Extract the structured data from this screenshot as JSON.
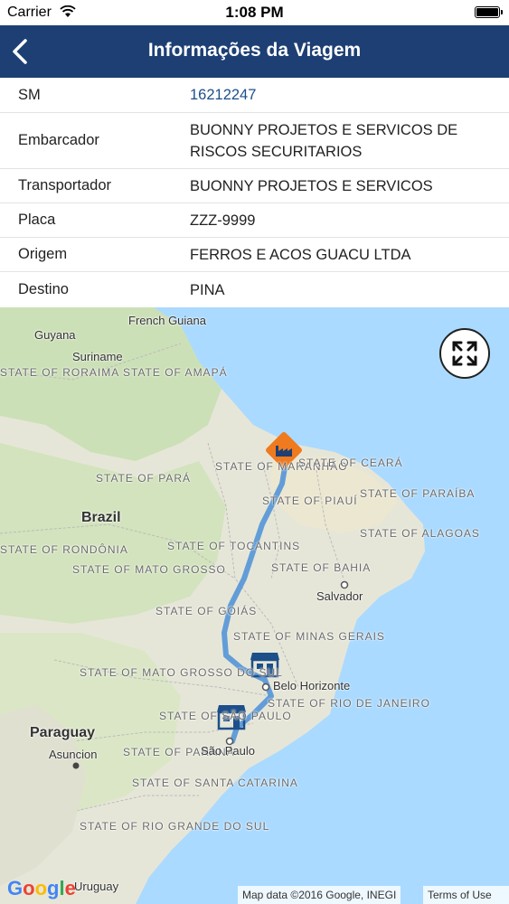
{
  "status_bar": {
    "carrier": "Carrier",
    "time": "1:08 PM"
  },
  "navbar": {
    "title": "Informações da Viagem"
  },
  "info_rows": [
    {
      "label": "SM",
      "value": "16212247"
    },
    {
      "label": "Embarcador",
      "value": "BUONNY PROJETOS E SERVICOS DE RISCOS SECURITARIOS"
    },
    {
      "label": "Transportador",
      "value": "BUONNY PROJETOS E SERVICOS"
    },
    {
      "label": "Placa",
      "value": "ZZZ-9999"
    },
    {
      "label": "Origem",
      "value": "FERROS E ACOS GUACU LTDA"
    },
    {
      "label": "Destino",
      "value": "PINA"
    }
  ],
  "map": {
    "labels": {
      "french_guiana": "French Guiana",
      "guyana": "Guyana",
      "suriname": "Suriname",
      "roraima": "STATE OF RORAIMA",
      "amapa": "STATE OF AMAPÁ",
      "para": "STATE OF PARÁ",
      "maranhao": "STATE OF MARANHÃO",
      "ceara": "STATE OF CEARÁ",
      "piaui": "STATE OF PIAUÍ",
      "paraiba": "STATE OF PARAÍBA",
      "alagoas": "STATE OF ALAGOAS",
      "tocantins": "STATE OF TOCANTINS",
      "bahia": "STATE OF BAHIA",
      "mato_grosso": "STATE OF MATO GROSSO",
      "goias": "STATE OF GOIÁS",
      "minas": "STATE OF MINAS GERAIS",
      "ms": "STATE OF MATO GROSSO DO SUL",
      "sp": "STATE OF SÃO PAULO",
      "rj": "STATE OF RIO DE JANEIRO",
      "parana": "STATE OF PARANÁ",
      "sc": "STATE OF SANTA CATARINA",
      "rs": "STATE OF RIO GRANDE DO SUL",
      "rondonia": "STATE OF RONDÔNIA",
      "brazil": "Brazil",
      "paraguay": "Paraguay",
      "asuncion": "Asuncion",
      "salvador": "Salvador",
      "belo_horizonte": "Belo Horizonte",
      "sao_paulo": "São Paulo",
      "uruguay": "Uruguay"
    },
    "google_logo": "Google",
    "attribution": "Map data ©2016 Google, INEGI",
    "terms": "Terms of Use",
    "colors": {
      "route": "#4a8fd8",
      "origin_marker": "#f07a1e",
      "store_marker": "#1d4f8a",
      "water": "#aadaff"
    }
  }
}
